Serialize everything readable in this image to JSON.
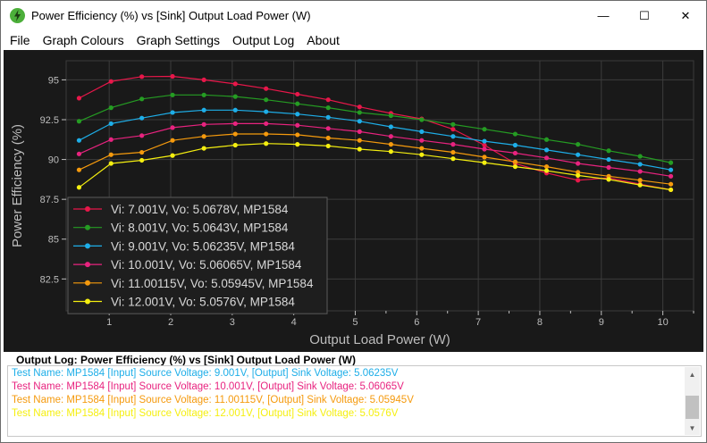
{
  "window": {
    "title": "Power Efficiency (%) vs [Sink] Output Load Power (W)",
    "minimize_glyph": "—",
    "maximize_glyph": "☐",
    "close_glyph": "✕"
  },
  "menu": [
    "File",
    "Graph Colours",
    "Graph Settings",
    "Output Log",
    "About"
  ],
  "colors": {
    "plot_background": "#191919",
    "grid": "#3c3c3c",
    "axis_text": "#bdbdbd",
    "legend_background": "#1e1e1e"
  },
  "chart_data": {
    "type": "line",
    "title": "",
    "xlabel": "Output Load Power (W)",
    "ylabel": "Power Efficiency (%)",
    "xlim": [
      0.3,
      10.5
    ],
    "ylim": [
      80.5,
      96.2
    ],
    "xticks": [
      1,
      2,
      3,
      4,
      5,
      6,
      7,
      8,
      9,
      10
    ],
    "yticks": [
      82.5,
      85,
      87.5,
      90,
      92.5,
      95
    ],
    "ytick_labels": [
      "82.5",
      "85",
      "87.5",
      "90",
      "92.5",
      "95"
    ],
    "grid": true,
    "legend_position": "bottom-left",
    "series": [
      {
        "name": "Vi: 7.001V, Vo: 5.0678V, MP1584",
        "color": "#e8174a",
        "x": [
          0.51,
          1.03,
          1.53,
          2.03,
          2.54,
          3.05,
          3.55,
          4.06,
          4.56,
          5.07,
          5.58,
          6.08,
          6.59,
          7.1,
          7.6,
          8.11,
          8.62,
          9.12,
          9.63,
          10.13
        ],
        "y": [
          93.85,
          94.9,
          95.2,
          95.22,
          95.0,
          94.75,
          94.45,
          94.1,
          93.75,
          93.3,
          92.9,
          92.55,
          91.9,
          90.9,
          89.75,
          89.15,
          88.7,
          88.85,
          88.45,
          88.1
        ]
      },
      {
        "name": "Vi: 8.001V, Vo: 5.0643V, MP1584",
        "color": "#259c23",
        "x": [
          0.51,
          1.03,
          1.53,
          2.03,
          2.54,
          3.05,
          3.55,
          4.06,
          4.56,
          5.07,
          5.58,
          6.08,
          6.59,
          7.1,
          7.6,
          8.11,
          8.62,
          9.12,
          9.63,
          10.13
        ],
        "y": [
          92.4,
          93.25,
          93.8,
          94.05,
          94.05,
          93.95,
          93.75,
          93.5,
          93.25,
          92.95,
          92.75,
          92.5,
          92.2,
          91.9,
          91.6,
          91.25,
          90.95,
          90.55,
          90.2,
          89.8
        ]
      },
      {
        "name": "Vi: 9.001V, Vo: 5.06235V, MP1584",
        "color": "#1eaee8",
        "x": [
          0.51,
          1.03,
          1.53,
          2.03,
          2.54,
          3.05,
          3.55,
          4.06,
          4.56,
          5.07,
          5.58,
          6.08,
          6.59,
          7.1,
          7.6,
          8.11,
          8.62,
          9.12,
          9.63,
          10.13
        ],
        "y": [
          91.2,
          92.25,
          92.6,
          92.95,
          93.1,
          93.1,
          93.0,
          92.85,
          92.65,
          92.4,
          92.05,
          91.75,
          91.45,
          91.15,
          90.9,
          90.6,
          90.3,
          90.0,
          89.7,
          89.35
        ]
      },
      {
        "name": "Vi: 10.001V, Vo: 5.06065V, MP1584",
        "color": "#e8237f",
        "x": [
          0.51,
          1.03,
          1.53,
          2.03,
          2.54,
          3.05,
          3.55,
          4.06,
          4.56,
          5.07,
          5.58,
          6.08,
          6.59,
          7.1,
          7.6,
          8.11,
          8.62,
          9.12,
          9.63,
          10.13
        ],
        "y": [
          90.35,
          91.25,
          91.5,
          92.0,
          92.2,
          92.25,
          92.25,
          92.15,
          91.95,
          91.75,
          91.45,
          91.2,
          90.95,
          90.65,
          90.4,
          90.1,
          89.75,
          89.5,
          89.25,
          88.95
        ]
      },
      {
        "name": "Vi: 11.00115V, Vo: 5.05945V, MP1584",
        "color": "#f59a0d",
        "x": [
          0.51,
          1.03,
          1.53,
          2.03,
          2.54,
          3.05,
          3.55,
          4.06,
          4.56,
          5.07,
          5.58,
          6.08,
          6.59,
          7.1,
          7.6,
          8.11,
          8.62,
          9.12,
          9.63,
          10.13
        ],
        "y": [
          89.35,
          90.3,
          90.45,
          91.2,
          91.45,
          91.6,
          91.6,
          91.55,
          91.35,
          91.2,
          90.95,
          90.7,
          90.45,
          90.15,
          89.85,
          89.55,
          89.2,
          88.95,
          88.7,
          88.45
        ]
      },
      {
        "name": "Vi: 12.001V, Vo: 5.0576V, MP1584",
        "color": "#f5ef10",
        "x": [
          0.51,
          1.03,
          1.53,
          2.03,
          2.54,
          3.05,
          3.55,
          4.06,
          4.56,
          5.07,
          5.58,
          6.08,
          6.59,
          7.1,
          7.6,
          8.11,
          8.62,
          9.12,
          9.63,
          10.13
        ],
        "y": [
          88.25,
          89.75,
          89.95,
          90.25,
          90.7,
          90.9,
          91.0,
          90.95,
          90.85,
          90.65,
          90.5,
          90.3,
          90.05,
          89.8,
          89.55,
          89.3,
          89.0,
          88.75,
          88.4,
          88.1
        ]
      }
    ]
  },
  "log": {
    "title": "Output Log: Power Efficiency (%) vs [Sink] Output Load Power (W)",
    "lines": [
      {
        "text": "Test Name: MP1584 [Input] Source Voltage: 9.001V, [Output] Sink Voltage: 5.06235V",
        "color": "#1eaee8"
      },
      {
        "text": "Test Name: MP1584 [Input] Source Voltage: 10.001V, [Output] Sink Voltage: 5.06065V",
        "color": "#e8237f"
      },
      {
        "text": "Test Name: MP1584 [Input] Source Voltage: 11.00115V, [Output] Sink Voltage: 5.05945V",
        "color": "#f59a0d"
      },
      {
        "text": "Test Name: MP1584 [Input] Source Voltage: 12.001V, [Output] Sink Voltage: 5.0576V",
        "color": "#f5ef10"
      }
    ]
  }
}
